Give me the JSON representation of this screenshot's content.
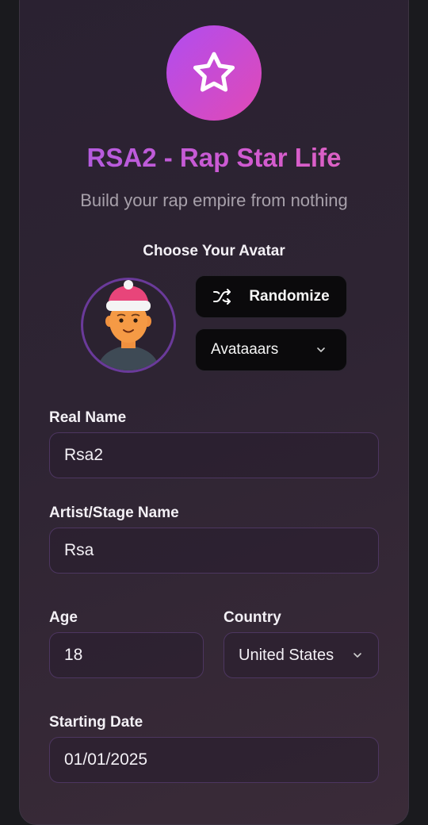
{
  "header": {
    "title": "RSA2 - Rap Star Life",
    "subtitle": "Build your rap empire from nothing",
    "logo_icon": "star-icon"
  },
  "avatar_section": {
    "label": "Choose Your Avatar",
    "randomize_label": "Randomize",
    "randomize_icon": "shuffle-icon",
    "style_value": "Avataaars"
  },
  "form": {
    "real_name": {
      "label": "Real Name",
      "value": "Rsa2"
    },
    "stage_name": {
      "label": "Artist/Stage Name",
      "value": "Rsa"
    },
    "age": {
      "label": "Age",
      "value": "18"
    },
    "country": {
      "label": "Country",
      "value": "United States"
    },
    "starting_date": {
      "label": "Starting Date",
      "value": "01/01/2025"
    }
  },
  "colors": {
    "accent_purple": "#a55ce6",
    "accent_pink": "#e14ab5",
    "background": "#2e2433",
    "input_border": "#4d3660"
  }
}
